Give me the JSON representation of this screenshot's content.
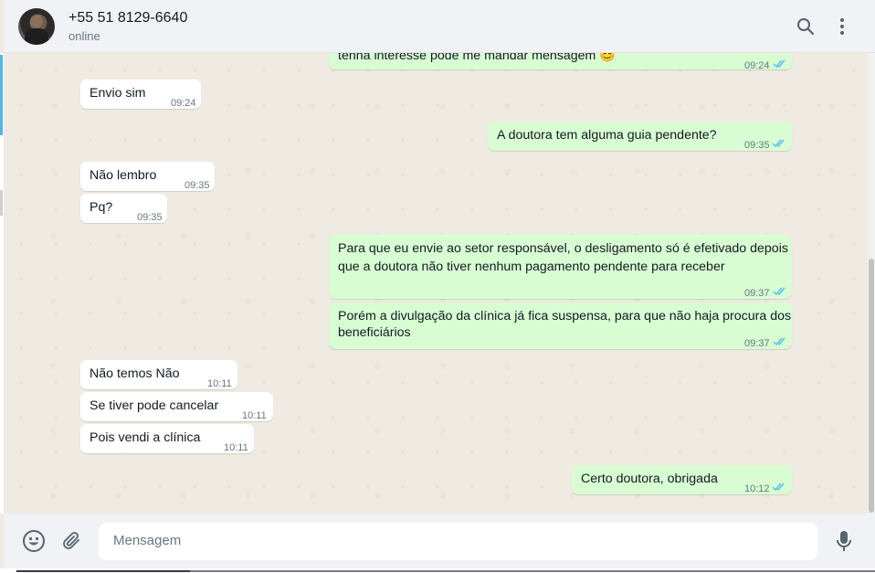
{
  "contact": {
    "name": "+55 51 8129-6640",
    "status": "online"
  },
  "messages": [
    {
      "dir": "out",
      "text": "tenha interesse pode me mandar mensagem 😊",
      "time": "09:24",
      "status": "read"
    },
    {
      "dir": "in",
      "text": "Envio sim",
      "time": "09:24"
    },
    {
      "dir": "out",
      "text": "A doutora tem alguma guia pendente?",
      "time": "09:35",
      "status": "read"
    },
    {
      "dir": "in",
      "text": "Não lembro",
      "time": "09:35"
    },
    {
      "dir": "in",
      "text": "Pq?",
      "time": "09:35"
    },
    {
      "dir": "out",
      "text_lines": [
        "Para que eu envie ao setor responsável, o desligamento só é efetivado depois",
        "que a doutora não tiver nenhum pagamento pendente para receber"
      ],
      "time": "09:37",
      "status": "read"
    },
    {
      "dir": "out",
      "text_lines": [
        "Porém a divulgação da clínica já fica suspensa, para que não haja procura dos",
        "beneficiários"
      ],
      "time": "09:37",
      "status": "read"
    },
    {
      "dir": "in",
      "text": "Não temos Não",
      "time": "10:11"
    },
    {
      "dir": "in",
      "text": "Se tiver pode cancelar",
      "time": "10:11"
    },
    {
      "dir": "in",
      "text": "Pois vendi a clínica",
      "time": "10:11"
    },
    {
      "dir": "out",
      "text": "Certo doutora, obrigada",
      "time": "10:12",
      "status": "read"
    }
  ],
  "composer": {
    "placeholder": "Mensagem"
  },
  "icons": {
    "header": [
      "search-icon",
      "menu-icon"
    ],
    "footer": [
      "emoji-icon",
      "attach-icon",
      "mic-icon"
    ],
    "read_receipt": "double-check-icon"
  },
  "colors": {
    "outgoing_bubble": "#d9fdd3",
    "incoming_bubble": "#ffffff",
    "chat_background": "#efeae2",
    "read_tick": "#53bdeb",
    "panel": "#f0f2f5"
  }
}
